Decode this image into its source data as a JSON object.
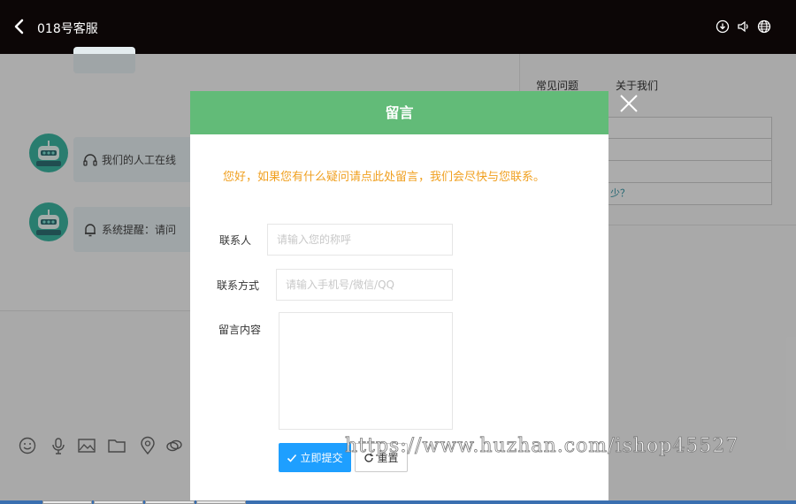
{
  "header": {
    "title": "018号客服"
  },
  "chat": {
    "messages": [
      {
        "text": "我们的人工在线"
      },
      {
        "text": "系统提醒：请问"
      }
    ]
  },
  "right_panel": {
    "tabs": [
      {
        "label": "常见问题"
      },
      {
        "label": "关于我们"
      }
    ],
    "items": [
      {
        "text": ""
      },
      {
        "text": ""
      },
      {
        "text": ""
      },
      {
        "text": "少？"
      }
    ]
  },
  "modal": {
    "title": "留言",
    "notice": "您好，如果您有什么疑问请点此处留言，我们会尽快与您联系。",
    "fields": {
      "name": {
        "label": "联系人",
        "placeholder": "请输入您的称呼"
      },
      "contact": {
        "label": "联系方式",
        "placeholder": "请输入手机号/微信/QQ"
      },
      "message": {
        "label": "留言内容",
        "placeholder": ""
      }
    },
    "submit_label": "立即提交",
    "reset_label": "重置"
  },
  "watermark": "https://www.huzhan.com/ishop45527",
  "icons": {
    "back": "chevron-left-icon",
    "download": "download-icon",
    "volume": "volume-icon",
    "globe": "globe-icon",
    "close": "close-icon",
    "emoji": "emoji-icon",
    "microphone": "microphone-icon",
    "image": "image-icon",
    "folder": "folder-icon",
    "location": "location-icon",
    "link": "link-icon",
    "headset": "headset-icon",
    "bell": "bell-icon",
    "check": "check-icon",
    "refresh": "refresh-icon"
  },
  "colors": {
    "topbar": "#0c0606",
    "modal_header": "#62bb78",
    "notice": "#f0a020",
    "primary_button": "#1e9fff",
    "avatar": "#3bb3a0"
  }
}
